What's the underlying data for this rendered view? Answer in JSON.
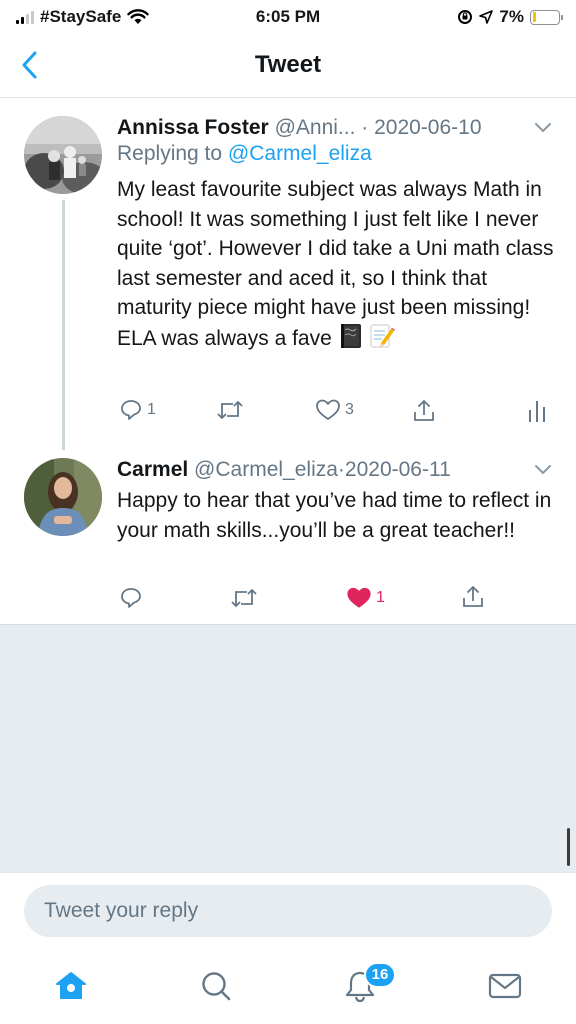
{
  "status_bar": {
    "carrier": "#StaySafe",
    "time": "6:05 PM",
    "battery": "7%"
  },
  "header": {
    "title": "Tweet",
    "back_icon": "chevron-left-icon"
  },
  "tweets": [
    {
      "name": "Annissa Foster",
      "handle": "@Anni...",
      "separator": " · ",
      "date": "2020-06-10",
      "replying_prefix": "Replying to ",
      "replying_handle": "@Carmel_eliza",
      "text": "My least favourite subject was always Math in school! It was something I just felt like I never quite ‘got’. However I did take a Uni math class last semester and aced it, so I think that maturity piece might have just been missing! ELA was always a fave",
      "emojis": [
        "notebook-emoji",
        "memo-emoji"
      ],
      "reply_count": "1",
      "retweet_count": "",
      "like_count": "3"
    },
    {
      "name": "Carmel",
      "handle": "@Carmel_eliza",
      "separator": "·",
      "date": "2020-06-11",
      "text": "Happy to hear that you’ve had time to reflect in your math skills...you’ll be a great teacher!!",
      "reply_count": "",
      "retweet_count": "",
      "like_count": "1",
      "liked": true
    }
  ],
  "reply_box": {
    "placeholder": "Tweet your reply"
  },
  "tab_bar": {
    "items": [
      "home-icon",
      "search-icon",
      "notifications-icon",
      "messages-icon"
    ],
    "notifications_badge": "16"
  },
  "colors": {
    "accent": "#1da1f2",
    "like": "#e0245e",
    "secondary_text": "#657786",
    "background_gray": "#e6ecf0"
  }
}
